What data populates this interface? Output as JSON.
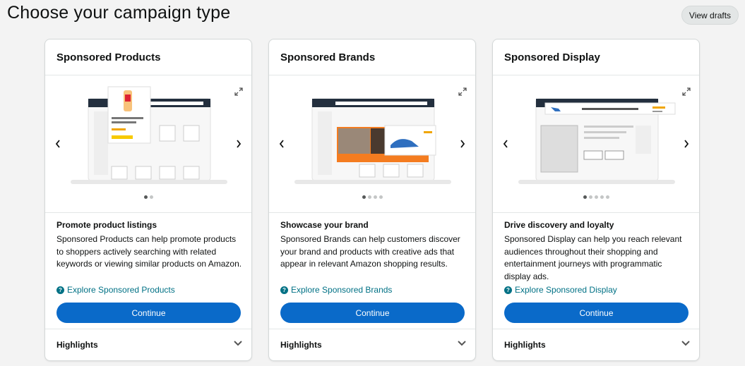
{
  "header": {
    "title": "Choose your campaign type",
    "view_drafts_label": "View drafts"
  },
  "cards": [
    {
      "title": "Sponsored Products",
      "feature_title": "Promote product listings",
      "description": "Sponsored Products can help promote products to shoppers actively searching with related keywords or viewing similar products on Amazon.",
      "explore_label": "Explore Sponsored Products",
      "continue_label": "Continue",
      "highlights_label": "Highlights",
      "carousel_slides": 2,
      "carousel_active": 1
    },
    {
      "title": "Sponsored Brands",
      "feature_title": "Showcase your brand",
      "description": "Sponsored Brands can help customers discover your brand and products with creative ads that appear in relevant Amazon shopping results.",
      "explore_label": "Explore Sponsored Brands",
      "continue_label": "Continue",
      "highlights_label": "Highlights",
      "carousel_slides": 4,
      "carousel_active": 1
    },
    {
      "title": "Sponsored Display",
      "feature_title": "Drive discovery and loyalty",
      "description": "Sponsored Display can help you reach relevant audiences throughout their shopping and entertainment journeys with programmatic display ads.",
      "explore_label": "Explore Sponsored Display",
      "continue_label": "Continue",
      "highlights_label": "Highlights",
      "carousel_slides": 5,
      "carousel_active": 1
    }
  ],
  "colors": {
    "primary_button": "#0a6ac9",
    "link": "#007185",
    "accent_orange": "#f47c20"
  },
  "icons": [
    "expand-icon",
    "chevron-left-icon",
    "chevron-right-icon",
    "help-icon",
    "chevron-down-icon"
  ]
}
